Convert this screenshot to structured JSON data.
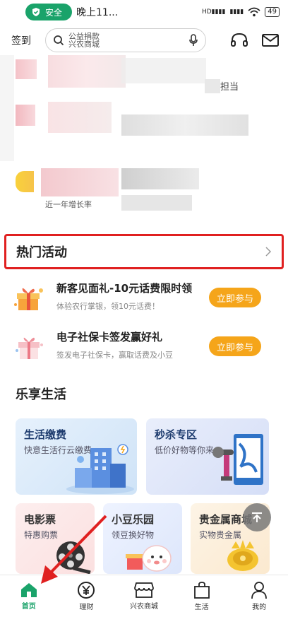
{
  "status": {
    "secure_label": "安全",
    "time": "晚上11...",
    "battery": "49"
  },
  "header": {
    "signin": "签到",
    "search_hint_line1": "公益捐款",
    "search_hint_line2": "兴农商城"
  },
  "blurred": {
    "fragment_1": "担当",
    "fragment_2": "近一年增长率"
  },
  "hot": {
    "title": "热门活动"
  },
  "activities": [
    {
      "title": "新客见面礼-10元话费限时领",
      "subtitle": "体验农行掌银，领10元话费！",
      "button": "立即参与"
    },
    {
      "title": "电子社保卡签发赢好礼",
      "subtitle": "签发电子社保卡，赢取话费及小豆",
      "button": "立即参与"
    }
  ],
  "life": {
    "title": "乐享生活",
    "cards": [
      {
        "title": "生活缴费",
        "subtitle": "快意生活行云缴费"
      },
      {
        "title": "秒杀专区",
        "subtitle": "低价好物等你来"
      },
      {
        "title": "电影票",
        "subtitle": "特惠购票"
      },
      {
        "title": "小豆乐园",
        "subtitle": "领豆换好物"
      },
      {
        "title": "贵金属商城",
        "subtitle": "实物贵金属"
      }
    ]
  },
  "nav": [
    {
      "label": "首页",
      "icon": "home-icon",
      "active": true
    },
    {
      "label": "理财",
      "icon": "yen-icon",
      "active": false
    },
    {
      "label": "兴农商城",
      "icon": "shop-icon",
      "active": false
    },
    {
      "label": "生活",
      "icon": "bag-icon",
      "active": false
    },
    {
      "label": "我的",
      "icon": "user-icon",
      "active": false
    }
  ],
  "colors": {
    "brand_green": "#1aa36a",
    "highlight_red": "#e02020",
    "button_orange": "#f5a51a"
  }
}
